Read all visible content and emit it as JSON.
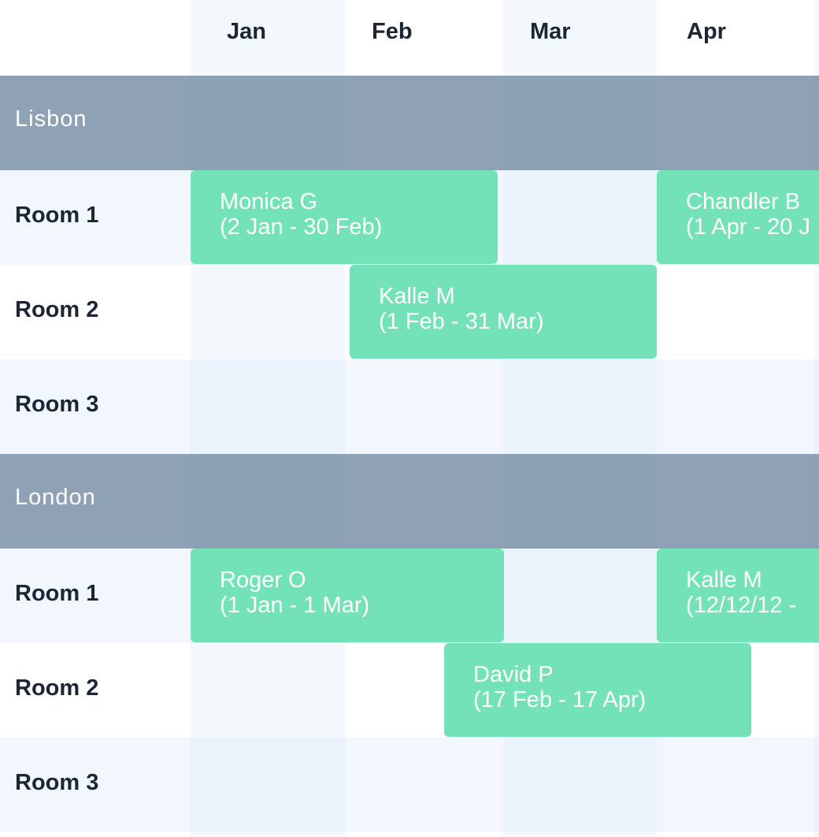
{
  "months": [
    "Jan",
    "Feb",
    "Mar",
    "Apr"
  ],
  "groups": [
    {
      "name": "Lisbon",
      "rooms": [
        "Room 1",
        "Room 2",
        "Room 3"
      ],
      "bookings": [
        {
          "room": "Room 1",
          "name": "Monica G",
          "dates": "(2 Jan - 30 Feb)"
        },
        {
          "room": "Room 1",
          "name": "Chandler B",
          "dates": "(1 Apr - 20 J"
        },
        {
          "room": "Room 2",
          "name": "Kalle M",
          "dates": "(1 Feb - 31 Mar)"
        }
      ]
    },
    {
      "name": "London",
      "rooms": [
        "Room 1",
        "Room 2",
        "Room 3"
      ],
      "bookings": [
        {
          "room": "Room 1",
          "name": "Roger O",
          "dates": "(1 Jan - 1 Mar)"
        },
        {
          "room": "Room 1",
          "name": "Kalle M",
          "dates": "(12/12/12 -"
        },
        {
          "room": "Room 2",
          "name": "David P",
          "dates": "(17 Feb - 17 Apr)"
        }
      ]
    }
  ],
  "colors": {
    "booking": "#73e3b7",
    "group_band": "#8a9eb4",
    "column_alt": "#f3f8fc",
    "text": "#1b2533"
  }
}
